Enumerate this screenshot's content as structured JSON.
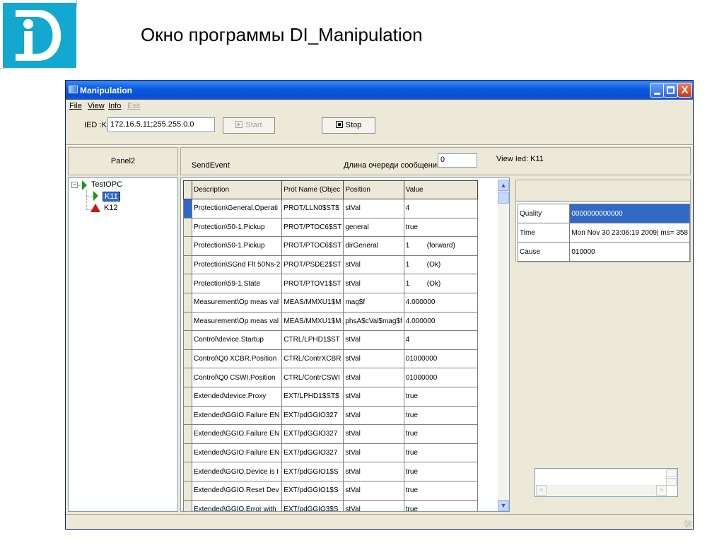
{
  "slide": {
    "title": "Окно программы DI_Manipulation",
    "logo_text": "Di"
  },
  "window": {
    "title": "Manipulation",
    "menu": [
      "File",
      "View",
      "Info",
      "Exit"
    ],
    "ied_label": "IED :K11",
    "ied_value": "172.16.5.11;255.255.0.0",
    "start_label": "Start",
    "stop_label": "Stop"
  },
  "panel": {
    "label": "Panel2",
    "tree": {
      "root": "TestOPC",
      "children": [
        "K11",
        "K12"
      ]
    }
  },
  "send": {
    "label": "SendEvent",
    "queue_label": "Длина очереди сообщений",
    "queue_value": "0",
    "view_ied": "View Ied: K11"
  },
  "grid": {
    "columns": [
      "Description",
      "Prot Name (Objec",
      "Position",
      "Value"
    ],
    "rows": [
      [
        "Protection\\General.Operati",
        "PROT/LLN0$ST$",
        "stVal",
        "4",
        ""
      ],
      [
        "Protection\\50-1.Pickup",
        "PROT/PTOC6$ST",
        "general",
        "true",
        ""
      ],
      [
        "Protection\\50-1.Pickup",
        "PROT/PTOC6$ST",
        "dirGeneral",
        "1",
        "(forward)"
      ],
      [
        "Protection\\SGnd Flt 50Ns-2",
        "PROT/PSDE2$ST",
        "stVal",
        "1",
        "(Ok)"
      ],
      [
        "Protection\\59-1.State",
        "PROT/PTOV1$ST",
        "stVal",
        "1",
        "(Ok)"
      ],
      [
        "Measurement\\Op meas val",
        "MEAS/MMXU1$M",
        "mag$f",
        "4.000000",
        ""
      ],
      [
        "Measurement\\Op meas val",
        "MEAS/MMXU1$M",
        "phsA$cVal$mag$f",
        "4.000000",
        ""
      ],
      [
        "Control\\device.Startup",
        "CTRL/LPHD1$ST",
        "stVal",
        "4",
        ""
      ],
      [
        "Control\\Q0 XCBR.Position",
        "CTRL/ContrXCBR",
        "stVal",
        "01000000",
        ""
      ],
      [
        "Control\\Q0 CSWI.Position",
        "CTRL/ContrCSWI",
        "stVal",
        "01000000",
        ""
      ],
      [
        "Extended\\device.Proxy",
        "EXT/LPHD1$ST$",
        "stVal",
        "true",
        ""
      ],
      [
        "Extended\\GGIO.Failure EN",
        "EXT/pdGGIO327",
        "stVal",
        "true",
        ""
      ],
      [
        "Extended\\GGIO.Failure EN",
        "EXT/pdGGIO327",
        "stVal",
        "true",
        ""
      ],
      [
        "Extended\\GGIO.Failure EN",
        "EXT/pdGGIO327",
        "stVal",
        "true",
        ""
      ],
      [
        "Extended\\GGIO.Device is I",
        "EXT/pdGGIO1$S",
        "stVal",
        "true",
        ""
      ],
      [
        "Extended\\GGIO.Reset Dev",
        "EXT/pdGGIO1$S",
        "stVal",
        "true",
        ""
      ],
      [
        "Extended\\GGIO.Error with",
        "EXT/pdGGIO3$S",
        "stVal",
        "true",
        ""
      ]
    ]
  },
  "details": {
    "rows": [
      {
        "key": "Quality",
        "value": "0000000000000"
      },
      {
        "key": "Time",
        "value": "Mon Nov 30 23:06:19 2009| ms= 358"
      },
      {
        "key": "Cause",
        "value": "010000"
      }
    ]
  },
  "icons": {
    "scroll_up": "▲",
    "scroll_down": "▼",
    "scroll_left": "<",
    "scroll_right": ">",
    "close": "X",
    "expander": "−"
  },
  "colors": {
    "titlebar": "#0a58e0",
    "selection": "#316ac5",
    "logo": "#12a8cf",
    "tree_green": "#10a010",
    "tree_red": "#d81010"
  }
}
